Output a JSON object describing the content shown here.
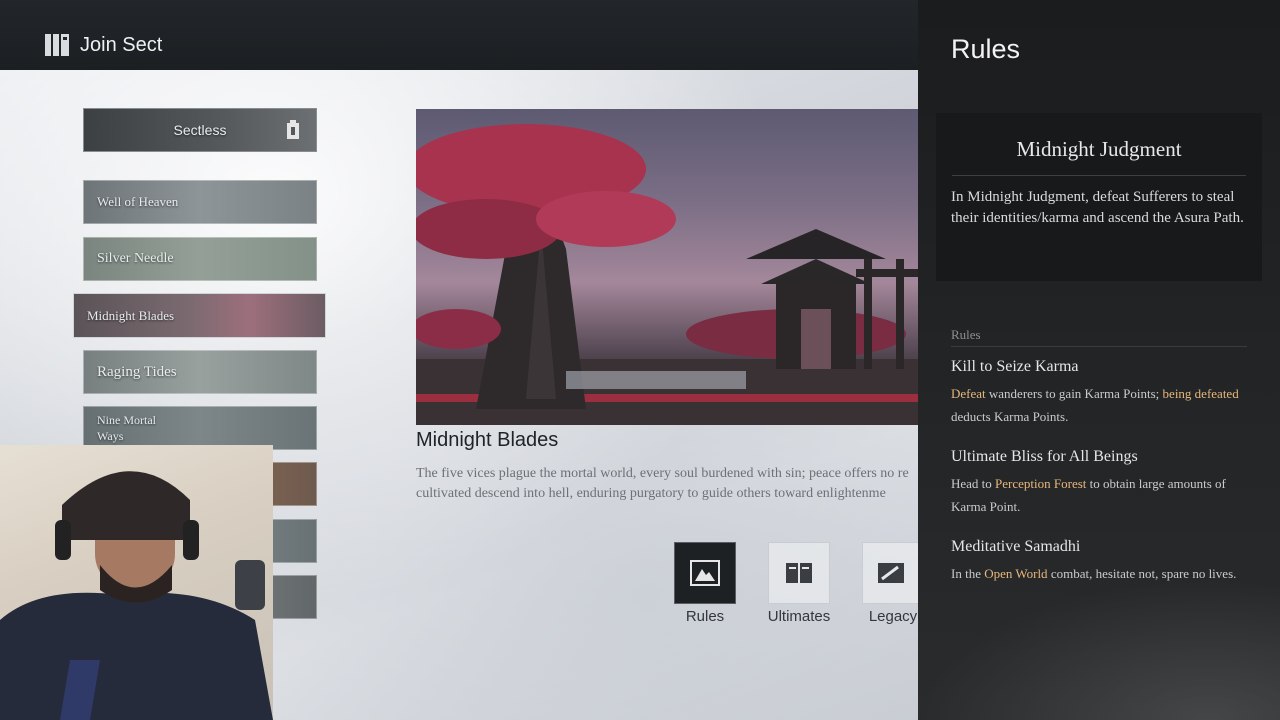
{
  "header": {
    "title": "Join Sect",
    "icon": "sect-book-icon"
  },
  "sect_list": {
    "items": [
      {
        "label": "Sectless",
        "selected_header": true
      },
      {
        "label": "Well of Heaven"
      },
      {
        "label": "Silver Needle"
      },
      {
        "label": "Midnight Blades",
        "active": true
      },
      {
        "label": "Raging Tides"
      },
      {
        "label": "Nine Mortal\nWays"
      },
      {
        "label": ""
      },
      {
        "label": ""
      },
      {
        "label": ""
      }
    ]
  },
  "main": {
    "sect_name": "Midnight Blades",
    "description": "The five vices plague the mortal world, every soul burdened with sin; peace offers no re\ncultivated descend into hell, enduring purgatory to guide others toward enlightenme",
    "tabs": [
      {
        "label": "Rules",
        "icon": "rules-icon",
        "active": true
      },
      {
        "label": "Ultimates",
        "icon": "book-icon"
      },
      {
        "label": "Legacy",
        "icon": "legacy-icon"
      }
    ]
  },
  "rules_panel": {
    "title": "Rules",
    "card": {
      "title": "Midnight Judgment",
      "text": "In Midnight Judgment, defeat Sufferers to steal their identities/karma and ascend the Asura Path."
    },
    "section_label": "Rules",
    "rules": [
      {
        "title": "Kill to Seize Karma",
        "parts": [
          {
            "text": "Defeat",
            "highlight": true
          },
          {
            "text": " wanderers to gain Karma Points; "
          },
          {
            "text": "being defeated",
            "highlight": true
          },
          {
            "text": " deducts Karma Points."
          }
        ]
      },
      {
        "title": "Ultimate Bliss for All Beings",
        "parts": [
          {
            "text": "Head to "
          },
          {
            "text": "Perception Forest",
            "highlight": true
          },
          {
            "text": " to obtain large amounts of Karma Point."
          }
        ]
      },
      {
        "title": "Meditative Samadhi",
        "parts": [
          {
            "text": "In the "
          },
          {
            "text": "Open World",
            "highlight": true
          },
          {
            "text": " combat, hesitate not, spare no lives."
          }
        ]
      }
    ]
  },
  "colors": {
    "highlight": "#e8b77c",
    "panel_bg": "#1f2123",
    "card_bg": "#17191b"
  }
}
